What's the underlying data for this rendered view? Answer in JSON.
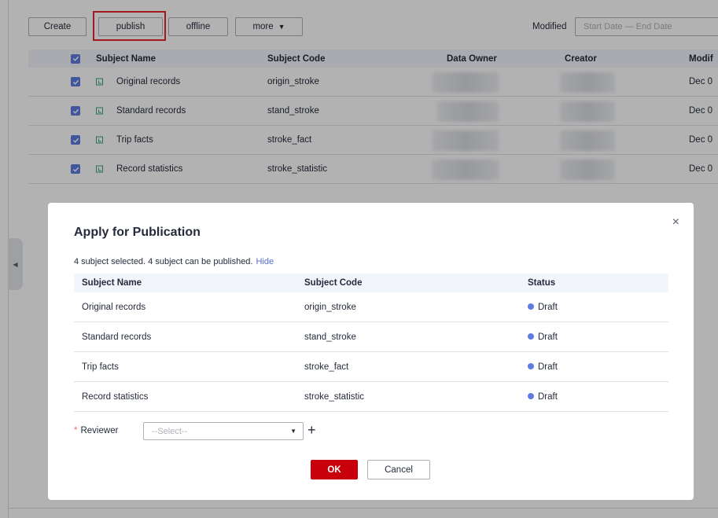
{
  "toolbar": {
    "create_label": "Create",
    "publish_label": "publish",
    "offline_label": "offline",
    "more_label": "more",
    "modified_label": "Modified",
    "date_placeholder": "Start Date — End Date"
  },
  "table": {
    "headers": [
      "Subject Name",
      "Subject Code",
      "Data Owner",
      "Creator",
      "Modif"
    ],
    "rows": [
      {
        "name": "Original records",
        "code": "origin_stroke",
        "modified": "Dec 0"
      },
      {
        "name": "Standard records",
        "code": "stand_stroke",
        "modified": "Dec 0"
      },
      {
        "name": "Trip facts",
        "code": "stroke_fact",
        "modified": "Dec 0"
      },
      {
        "name": "Record statistics",
        "code": "stroke_statistic",
        "modified": "Dec 0"
      }
    ]
  },
  "modal": {
    "title": "Apply for Publication",
    "info_text": "4 subject selected. 4 subject can be published.",
    "hide_label": "Hide",
    "headers": [
      "Subject Name",
      "Subject Code",
      "Status"
    ],
    "rows": [
      {
        "name": "Original records",
        "code": "origin_stroke",
        "status": "Draft"
      },
      {
        "name": "Standard records",
        "code": "stand_stroke",
        "status": "Draft"
      },
      {
        "name": "Trip facts",
        "code": "stroke_fact",
        "status": "Draft"
      },
      {
        "name": "Record statistics",
        "code": "stroke_statistic",
        "status": "Draft"
      }
    ],
    "reviewer_required_mark": "*",
    "reviewer_label": "Reviewer",
    "reviewer_placeholder": "--Select--",
    "ok_label": "OK",
    "cancel_label": "Cancel",
    "close_glyph": "×",
    "add_glyph": "+"
  },
  "colors": {
    "accent": "#5e7ce0",
    "primary_button": "#c7000b",
    "highlight_border": "#e6262b",
    "status_draft": "#5e7ce0"
  },
  "icons": [
    "checkbox-checked-icon",
    "table-icon",
    "caret-down-icon",
    "close-icon",
    "plus-icon",
    "collapse-arrow-icon"
  ]
}
